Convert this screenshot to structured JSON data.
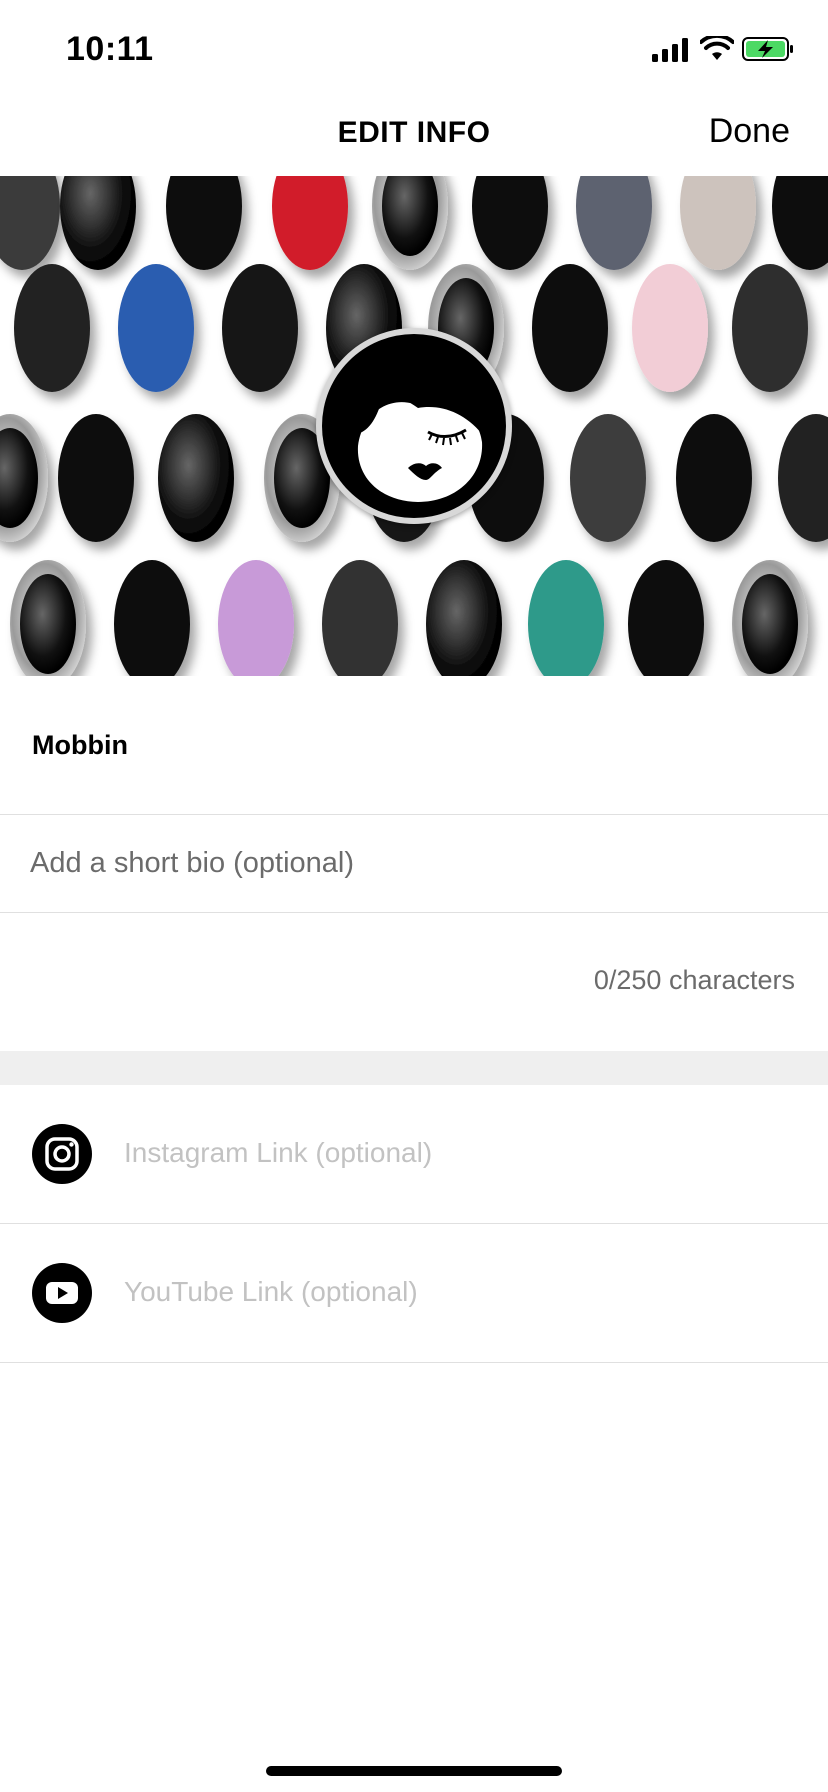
{
  "status_bar": {
    "time": "10:11",
    "icons": [
      "signal-icon",
      "wifi-icon",
      "battery-charging-icon"
    ],
    "battery_color": "#4cd964"
  },
  "nav": {
    "title": "EDIT INFO",
    "done_label": "Done"
  },
  "cover": {
    "image": "cover-photo",
    "avatar_icon": "face-logo-icon"
  },
  "profile": {
    "name": "Mobbin"
  },
  "bio": {
    "value": "",
    "placeholder": "Add a short bio (optional)",
    "counter": "0/250 characters"
  },
  "links": {
    "instagram": {
      "icon": "instagram-icon",
      "value": "",
      "placeholder": "Instagram Link (optional)"
    },
    "youtube": {
      "icon": "youtube-icon",
      "value": "",
      "placeholder": "YouTube Link (optional)"
    }
  },
  "colors": {
    "separator": "#e0e0e0",
    "section_gap": "#efefef",
    "placeholder_muted": "#c2c2c2",
    "secondary_text": "#6b6b6b"
  }
}
